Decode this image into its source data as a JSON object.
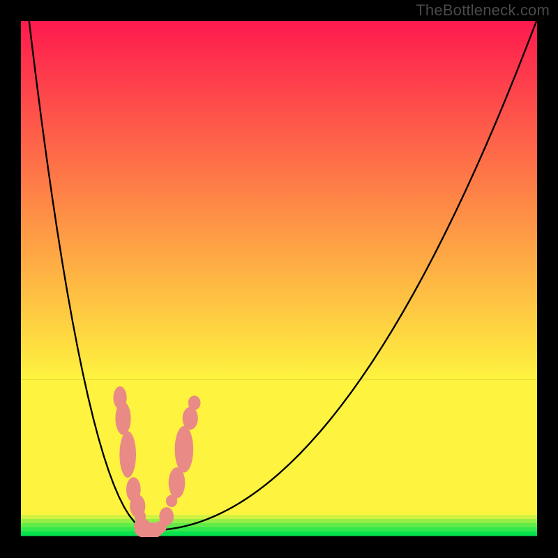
{
  "watermark": "TheBottleneck.com",
  "colors": {
    "bg": "#000000",
    "curve": "#000000",
    "marker_fill": "#e98a87",
    "green0": "#06e24d",
    "green1": "#34e84b",
    "green2": "#60eb48",
    "green3": "#95ee45",
    "green4": "#d2f242",
    "yellow": "#fef33f",
    "grad_top": "#fe1a4e",
    "grad_bot": "#fef33f"
  },
  "chart_data": {
    "type": "line",
    "title": "",
    "xlabel": "",
    "ylabel": "",
    "xlim": [
      0,
      100
    ],
    "ylim": [
      0,
      100
    ],
    "curve": {
      "x_min_at": 25,
      "coeff_left": 0.18,
      "coeff_right": 0.0176,
      "samples_x": [
        0,
        1,
        2,
        3,
        4,
        5,
        6,
        7,
        8,
        9,
        10,
        11,
        12,
        13,
        14,
        15,
        16,
        17,
        18,
        19,
        20,
        21,
        22,
        23,
        24,
        25,
        26,
        27,
        28,
        29,
        30,
        31,
        32,
        33,
        34,
        35,
        36,
        37,
        38,
        39,
        40,
        41,
        42,
        43,
        44,
        45,
        46,
        47,
        48,
        49,
        50,
        52,
        54,
        56,
        58,
        60,
        62,
        64,
        66,
        68,
        70,
        72,
        74,
        76,
        78,
        80,
        82,
        84,
        86,
        88,
        90,
        92,
        94,
        96,
        98,
        100
      ]
    },
    "markers": [
      {
        "x": 19.2,
        "y": 27.0,
        "rx": 1.3,
        "ry": 2.2
      },
      {
        "x": 19.8,
        "y": 23.0,
        "rx": 1.5,
        "ry": 3.2
      },
      {
        "x": 20.7,
        "y": 16.0,
        "rx": 1.6,
        "ry": 4.5
      },
      {
        "x": 21.8,
        "y": 9.2,
        "rx": 1.4,
        "ry": 2.4
      },
      {
        "x": 22.6,
        "y": 6.0,
        "rx": 1.5,
        "ry": 2.2
      },
      {
        "x": 23.1,
        "y": 4.0,
        "rx": 1.1,
        "ry": 1.2
      },
      {
        "x": 23.5,
        "y": 2.2,
        "rx": 1.6,
        "ry": 1.4
      },
      {
        "x": 24.5,
        "y": 1.3,
        "rx": 2.5,
        "ry": 1.5
      },
      {
        "x": 25.5,
        "y": 1.3,
        "rx": 2.0,
        "ry": 1.5
      },
      {
        "x": 27.0,
        "y": 1.9,
        "rx": 1.2,
        "ry": 1.2
      },
      {
        "x": 28.2,
        "y": 4.0,
        "rx": 1.4,
        "ry": 1.8
      },
      {
        "x": 29.2,
        "y": 7.0,
        "rx": 1.1,
        "ry": 1.2
      },
      {
        "x": 30.2,
        "y": 10.5,
        "rx": 1.6,
        "ry": 3.0
      },
      {
        "x": 31.6,
        "y": 17.0,
        "rx": 1.8,
        "ry": 4.5
      },
      {
        "x": 32.8,
        "y": 23.0,
        "rx": 1.5,
        "ry": 2.2
      },
      {
        "x": 33.6,
        "y": 26.0,
        "rx": 1.2,
        "ry": 1.4
      }
    ],
    "green_bands_y": [
      95.8,
      96.7,
      97.5,
      98.3,
      99.1
    ],
    "yellow_band_y": 30.5
  }
}
